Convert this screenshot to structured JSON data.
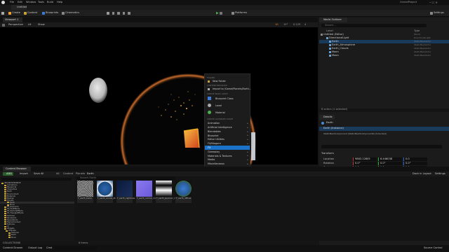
{
  "menu": {
    "items": [
      "File",
      "Edit",
      "Window",
      "Tools",
      "Build",
      "Help"
    ],
    "project": "UnrealProject",
    "doc_tab": "Untitled"
  },
  "toolbar": {
    "select_mode": "Selection Mode",
    "create": "Create",
    "content": "Content",
    "blueprints": "Blueprints",
    "cinematics": "Cinematics",
    "platforms": "Platforms",
    "settings": "Settings"
  },
  "viewport": {
    "tab": "Viewport 1",
    "perspective": "Perspective",
    "lit": "Lit",
    "show": "Show",
    "grid": "10",
    "angle": "10°",
    "scale": "0.125",
    "speed": "4"
  },
  "outliner": {
    "tab": "World Outliner",
    "search_placeholder": "Search...",
    "col_label": "Label",
    "col_type": "Type",
    "rows": [
      {
        "label": "Untitled (Editor)",
        "type": "World"
      },
      {
        "label": "DirectionalLight",
        "type": "DirectionalLight"
      },
      {
        "label": "Earth",
        "type": "StaticMeshActor"
      },
      {
        "label": "Earth_Atmosphere",
        "type": "StaticMeshActor"
      },
      {
        "label": "Earth_Clouds",
        "type": "StaticMeshActor"
      },
      {
        "label": "Moon",
        "type": "StaticMeshActor"
      },
      {
        "label": "Moon",
        "type": "StaticMeshActor"
      }
    ],
    "count": "6 actors (1 selected)"
  },
  "details": {
    "tab": "Details",
    "actor": "Earth",
    "component": "Earth (Instance)",
    "mesh_component": "StaticMeshComponent (StaticMeshComponent0) (Inherited)",
    "section": "Transform",
    "rows": [
      {
        "label": "Location",
        "x": "9863.12805",
        "y": "6.446038",
        "z": "0.0"
      },
      {
        "label": "Rotation",
        "x": "0.0°",
        "y": "0.0°",
        "z": "0.0°"
      },
      {
        "label": "Scale",
        "x": "1.0",
        "y": "1.0",
        "z": "1.0"
      }
    ]
  },
  "context_menu": {
    "header_folder": "FOLDER",
    "new_folder": "New Folder",
    "header_import": "CONTENT BROWSER",
    "import": "Import to /Game/Planets/Earth...",
    "header_basic": "CREATE BASIC ASSET",
    "basic": [
      "Blueprint Class",
      "Level",
      "Material"
    ],
    "header_advanced": "CREATE ADVANCED ASSET",
    "advanced": [
      "Animation",
      "Artificial Intelligence",
      "Blendables",
      "Blueprint",
      "Editor Utilities",
      "FX/Niagara",
      "Gameplay",
      "Materials & Textures",
      "Media",
      "Miscellaneous",
      "Paper2D",
      "Physics",
      "Sounds",
      "User Interface",
      "World",
      "Add Cloned Content"
    ],
    "highlighted": "FX"
  },
  "submenu": {
    "item": "Static Waves"
  },
  "content_browser": {
    "tab": "Content Browser",
    "add": "ADD",
    "import": "Import",
    "save_all": "Save All",
    "path": [
      "All",
      "Content",
      "Planets",
      "Earth"
    ],
    "search_placeholder": "Search Earth",
    "count": "6 items",
    "dock": "Dock in Layout",
    "settings": "Settings",
    "folders": [
      "IMAGEOVERDRIVE",
      "Animations",
      "Blueprints",
      "Characters",
      "Earth",
      "Environment",
      "Materials",
      "Meshes",
      "Planets",
      "Earth",
      "Moon",
      "PS_Explosion",
      "PS_FireEffects",
      "PS_ParticleEffects",
      "PS_TriangleEffects",
      "Particles",
      "Reviewers",
      "SpaceRocks",
      "StarterContent",
      "Textures",
      "UI",
      "Widgets",
      "zPlanets",
      "Textures",
      "Earth",
      "Moon"
    ],
    "collections": "COLLECTIONS",
    "assets": [
      {
        "name": "T_earth_bump",
        "kind": "bump"
      },
      {
        "name": "T_earth_clouds_4k",
        "kind": "clouds"
      },
      {
        "name": "T_earth_nightmap",
        "kind": "night"
      },
      {
        "name": "T_earth_normal_map",
        "kind": "normal"
      },
      {
        "name": "T_earth_specular_map",
        "kind": "spec"
      },
      {
        "name": "T_earth_diffuse",
        "kind": "diffuse"
      }
    ]
  },
  "status": {
    "content_drawer": "Content Drawer",
    "output_log": "Output Log",
    "cmd": "Cmd",
    "source_control": "Source Control"
  },
  "colors": {
    "accent": "#0070e0",
    "highlight": "#1a73c8",
    "orange": "#f08020",
    "earth_glow": "#d9702a"
  }
}
